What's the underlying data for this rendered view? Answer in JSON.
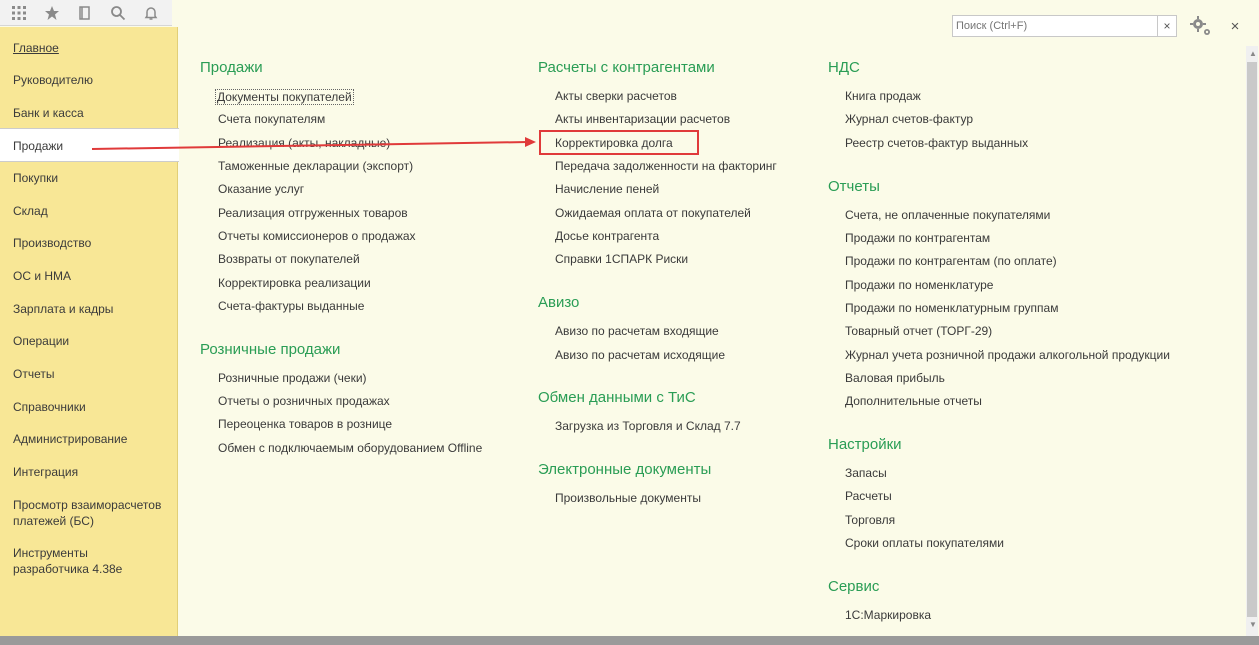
{
  "toolbar": {
    "icons": [
      "apps-grid-icon",
      "star-icon",
      "history-icon",
      "search-icon",
      "bell-icon"
    ]
  },
  "sidebar": {
    "items": [
      {
        "label": "Главное"
      },
      {
        "label": "Руководителю"
      },
      {
        "label": "Банк и касса"
      },
      {
        "label": "Продажи"
      },
      {
        "label": "Покупки"
      },
      {
        "label": "Склад"
      },
      {
        "label": "Производство"
      },
      {
        "label": "ОС и НМА"
      },
      {
        "label": "Зарплата и кадры"
      },
      {
        "label": "Операции"
      },
      {
        "label": "Отчеты"
      },
      {
        "label": "Справочники"
      },
      {
        "label": "Администрирование"
      },
      {
        "label": "Интеграция"
      },
      {
        "label": "Просмотр взаиморасчетов платежей (БС)"
      },
      {
        "label": "Инструменты разработчика 4.38е"
      }
    ],
    "active_index": 3
  },
  "search": {
    "placeholder": "Поиск (Ctrl+F)",
    "clear_label": "×"
  },
  "close_label": "×",
  "colors": {
    "section_title": "#2a9d55",
    "sidebar_bg": "#f8e796",
    "page_bg": "#fbfbe8",
    "highlight": "#e03a3a"
  },
  "col1": {
    "sales_title": "Продажи",
    "sales_links": [
      "Документы покупателей",
      "Счета покупателям",
      "Реализация (акты, накладные)",
      "Таможенные декларации (экспорт)",
      "Оказание услуг",
      "Реализация отгруженных товаров",
      "Отчеты комиссионеров о продажах",
      "Возвраты от покупателей",
      "Корректировка реализации",
      "Счета-фактуры выданные"
    ],
    "retail_title": "Розничные продажи",
    "retail_links": [
      "Розничные продажи (чеки)",
      "Отчеты о розничных продажах",
      "Переоценка товаров в рознице",
      "Обмен с подключаемым оборудованием Offline"
    ]
  },
  "col2": {
    "settlements_title": "Расчеты с контрагентами",
    "settlements_links": [
      "Акты сверки расчетов",
      "Акты инвентаризации расчетов",
      "Корректировка долга",
      "Передача задолженности на факторинг",
      "Начисление пеней",
      "Ожидаемая оплата от покупателей",
      "Досье контрагента",
      "Справки 1СПАРК Риски"
    ],
    "aviso_title": "Авизо",
    "aviso_links": [
      "Авизо по расчетам входящие",
      "Авизо по расчетам исходящие"
    ],
    "exchange_title": "Обмен данными с ТиС",
    "exchange_links": [
      "Загрузка из Торговля и Склад 7.7"
    ],
    "edocs_title": "Электронные документы",
    "edocs_links": [
      "Произвольные документы"
    ]
  },
  "col3": {
    "vat_title": "НДС",
    "vat_links": [
      "Книга продаж",
      "Журнал счетов-фактур",
      "Реестр счетов-фактур выданных"
    ],
    "reports_title": "Отчеты",
    "reports_links": [
      "Счета, не оплаченные покупателями",
      "Продажи по контрагентам",
      "Продажи по контрагентам (по оплате)",
      "Продажи по номенклатуре",
      "Продажи по номенклатурным группам",
      "Товарный отчет (ТОРГ-29)",
      "Журнал учета розничной продажи алкогольной продукции",
      "Валовая прибыль",
      "Дополнительные отчеты"
    ],
    "settings_title": "Настройки",
    "settings_links": [
      "Запасы",
      "Расчеты",
      "Торговля",
      "Сроки оплаты покупателями"
    ],
    "service_title": "Сервис",
    "service_links": [
      "1С:Маркировка"
    ]
  }
}
